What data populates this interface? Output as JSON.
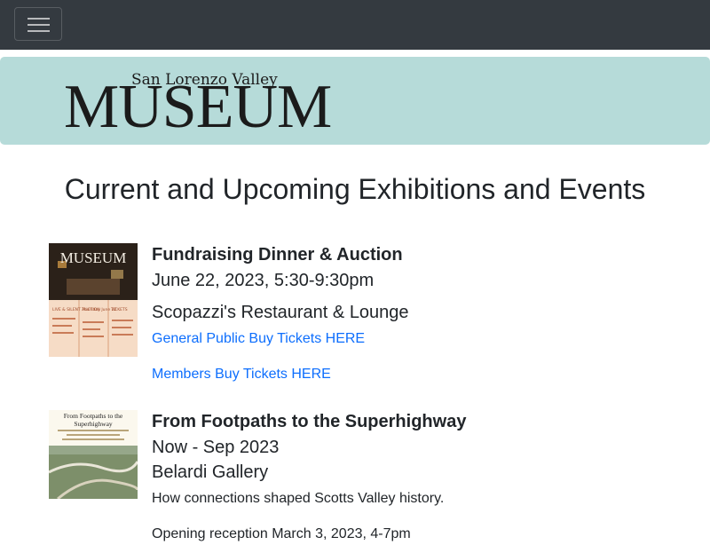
{
  "nav": {
    "toggle_icon": "hamburger-menu-icon"
  },
  "banner": {
    "logo_sub": "San Lorenzo Valley",
    "logo_main": "MUSEUM"
  },
  "page_title": "Current and Upcoming Exhibitions and Events",
  "events": [
    {
      "title": "Fundraising Dinner & Auction",
      "date": "June 22, 2023, 5:30-9:30pm",
      "location": "Scopazzi's Restaurant & Lounge",
      "link1": "General Public Buy Tickets HERE",
      "link2": "Members Buy Tickets HERE",
      "thumb": {
        "logo": "MUSEUM",
        "col1": "LIVE & SILENT AUCTION",
        "col2": "Thursday June 22",
        "col3": "TICKETS"
      }
    },
    {
      "title": "From Footpaths to the Superhighway",
      "date": "Now - Sep 2023",
      "location": "Belardi Gallery",
      "description": "How connections shaped Scotts Valley history.",
      "reception": "Opening reception March 3, 2023, 4-7pm",
      "thumb": {
        "heading": "From Footpaths to the Superhighway"
      }
    }
  ],
  "colors": {
    "nav_bg": "#343a40",
    "banner_bg": "#b6dbd9",
    "link": "#0d6efd"
  }
}
